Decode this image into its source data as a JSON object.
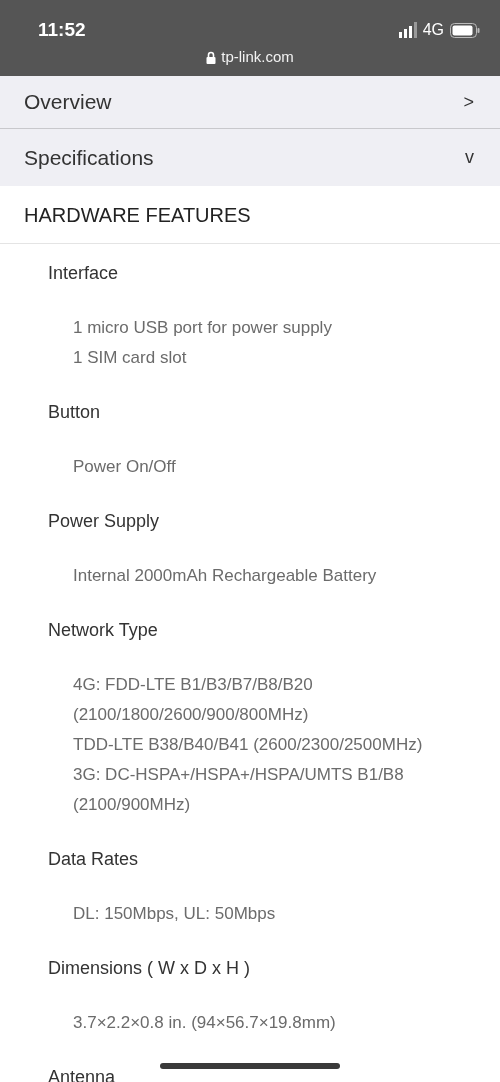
{
  "status_bar": {
    "time": "11:52",
    "network": "4G",
    "url": "tp-link.com"
  },
  "accordion": [
    {
      "label": "Overview",
      "indicator": ">"
    },
    {
      "label": "Specifications",
      "indicator": "v"
    }
  ],
  "section_title": "HARDWARE FEATURES",
  "specs": [
    {
      "name": "Interface",
      "values": [
        "1 micro USB port for power supply",
        "1 SIM card slot"
      ]
    },
    {
      "name": "Button",
      "values": [
        "Power On/Off"
      ]
    },
    {
      "name": "Power Supply",
      "values": [
        "Internal 2000mAh Rechargeable Battery"
      ]
    },
    {
      "name": "Network Type",
      "values": [
        "4G: FDD-LTE B1/B3/B7/B8/B20",
        "(2100/1800/2600/900/800MHz)",
        "TDD-LTE B38/B40/B41 (2600/2300/2500MHz)",
        "3G: DC-HSPA+/HSPA+/HSPA/UMTS B1/B8",
        "(2100/900MHz)"
      ]
    },
    {
      "name": "Data Rates",
      "values": [
        "DL: 150Mbps, UL: 50Mbps"
      ]
    },
    {
      "name": "Dimensions ( W x D x H )",
      "values": [
        "3.7×2.2×0.8 in. (94×56.7×19.8mm)"
      ]
    },
    {
      "name": "Antenna"
    }
  ]
}
